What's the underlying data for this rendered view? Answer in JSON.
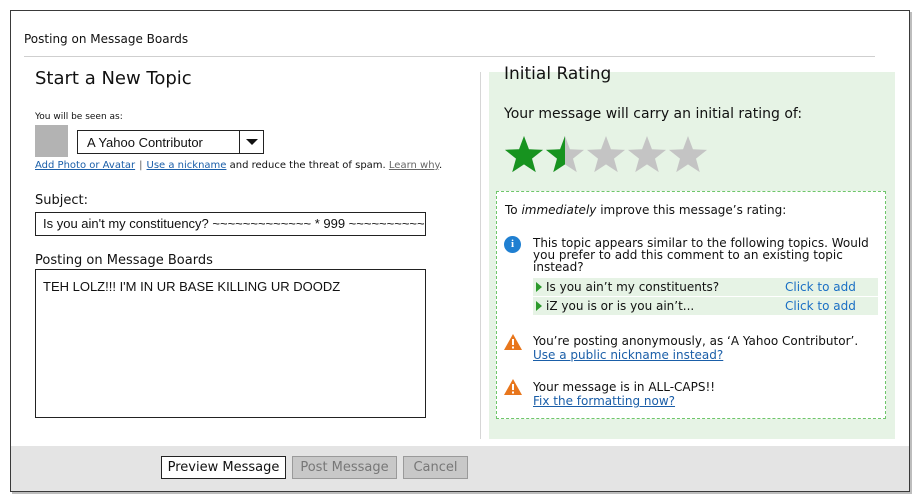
{
  "header": {
    "title": "Posting on Message Boards"
  },
  "form": {
    "heading": "Start a New Topic",
    "seen_as_label": "You will be seen as:",
    "identity_select": {
      "value": "A Yahoo Contributor"
    },
    "links": {
      "add_photo": "Add Photo or Avatar",
      "separator": "|",
      "use_nickname": "Use a nickname",
      "nickname_suffix": "and reduce the threat of spam.",
      "learn_why": "Learn why"
    },
    "subject_label": "Subject:",
    "subject_value": "Is you ain't my constituency? ~~~~~~~~~~~~~ * 999 ~~~~~~~~~~~~",
    "body_label": "Posting on Message Boards",
    "body_value": "TEH LOLZ!!! I'M IN UR BASE KILLING UR DOODZ"
  },
  "rating": {
    "heading": "Initial Rating",
    "subtitle": "Your message will carry an initial rating of:",
    "stars_value": 1.5,
    "stars_max": 5,
    "colors": {
      "filled": "#17931f",
      "empty": "#c4c4c4",
      "panel": "#e6f3e5",
      "link": "#1a5ea8",
      "warning": "#e8761c",
      "info": "#1f7fd1"
    },
    "improve": {
      "title_prefix": "To ",
      "title_emphasis": "immediately",
      "title_suffix": " improve this message’s rating:",
      "similar_text": "This topic appears similar to the following topics. Would you prefer to add this comment to an existing topic instead?",
      "topics": [
        {
          "label": "Is you ain’t my constituents?",
          "action": "Click to add"
        },
        {
          "label": "iZ you is or is you ain’t...",
          "action": "Click to add"
        }
      ],
      "anon_warning": "You’re posting anonymously, as ‘A Yahoo Contributor’.",
      "anon_link": "Use a public nickname instead?",
      "caps_warning": "Your message is in ALL-CAPS!!",
      "caps_link": "Fix the formatting now?",
      "icons": {
        "info": "info-icon",
        "warning": "warning-icon"
      }
    }
  },
  "footer": {
    "preview_label": "Preview Message",
    "post_label": "Post Message",
    "cancel_label": "Cancel"
  }
}
